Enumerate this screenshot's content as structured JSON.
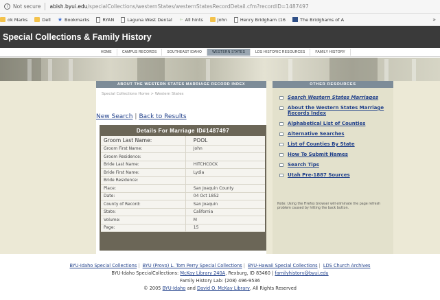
{
  "browser": {
    "security_label": "Not secure",
    "url_host": "abish.byui.edu",
    "url_path": "/specialCollections/westernStates/westernStatesRecordDetail.cfm?recordID=1487497",
    "bookmarks": [
      {
        "label": "ok Marks",
        "icon": "folder-icon"
      },
      {
        "label": "Dell",
        "icon": "folder-icon"
      },
      {
        "label": "Bookmarks",
        "icon": "star-icon"
      },
      {
        "label": "RYAN",
        "icon": "page-icon"
      },
      {
        "label": "Laguna West Dental",
        "icon": "page-icon"
      },
      {
        "label": "All hints",
        "icon": "dots-icon"
      },
      {
        "label": "John",
        "icon": "folder-icon"
      },
      {
        "label": "Henry Bridgham (16",
        "icon": "page-icon"
      },
      {
        "label": "The Bridghams of A",
        "icon": "square-icon"
      }
    ],
    "more_label": "»"
  },
  "site": {
    "title": "Special Collections & Family History",
    "nav": [
      "HOME",
      "CAMPUS RECORDS",
      "SOUTHEAST IDAHO",
      "WESTERN STATES",
      "LDS HISTORIC RESOURCES",
      "FAMILY HISTORY"
    ],
    "active_nav": "WESTERN STATES"
  },
  "main": {
    "header": "ABOUT THE WESTERN STATES MARRIAGE RECORD INDEX",
    "breadcrumb": "Special Collections Home > Western States",
    "new_search": "New Search",
    "back": "Back to Results",
    "details_title": "Details For Marriage ID#1487497",
    "rows": [
      {
        "label": "Groom Last Name:",
        "value": "POOL"
      },
      {
        "label": "Groom First Name:",
        "value": "John"
      },
      {
        "label": "Groom Residence:",
        "value": ""
      },
      {
        "label": "Bride Last Name:",
        "value": "HITCHCOCK"
      },
      {
        "label": "Bride First Name:",
        "value": "Lydia"
      },
      {
        "label": "Bride Residence:",
        "value": ""
      },
      {
        "label": "Place:",
        "value": "San Joaquin County"
      },
      {
        "label": "Date:",
        "value": "04 Oct 1852"
      },
      {
        "label": "County of Record:",
        "value": "San Joaquin"
      },
      {
        "label": "State:",
        "value": "California"
      },
      {
        "label": "Volume:",
        "value": "M"
      },
      {
        "label": "Page:",
        "value": "15"
      }
    ]
  },
  "side": {
    "header": "OTHER RESOURCES",
    "items": [
      "Search Western States Marriages",
      "About the Western States Marriage Records Index",
      "Alphabetical List of Counties",
      "Alternative Searches",
      "List of Counties By State",
      "How To Submit Names",
      "Search Tips",
      "Utah Pre-1887 Sources"
    ],
    "note": "Note: Using the Firefox browser will eliminate the page refresh problem caused by hitting the back button."
  },
  "footer": {
    "links": [
      "BYU-Idaho Special Collections",
      "BYU (Provo) L. Tom Perry Special Collections",
      "BYU-Hawaii Special Collections",
      "LDS Church Archives"
    ],
    "address_prefix": "BYU-Idaho SpecialCollections:",
    "address_link": "McKay Library 240A",
    "address_rest": ", Rexburg, ID 83460 |",
    "email": "familyhistory@byui.edu",
    "lab": "Family History Lab: (208) 496-9536",
    "copyright_prefix": "© 2005",
    "copyright_link1": "BYU-Idaho",
    "copyright_and": "and",
    "copyright_link2": "David O. McKay Library",
    "copyright_rest": ", All Rights Reserved"
  }
}
